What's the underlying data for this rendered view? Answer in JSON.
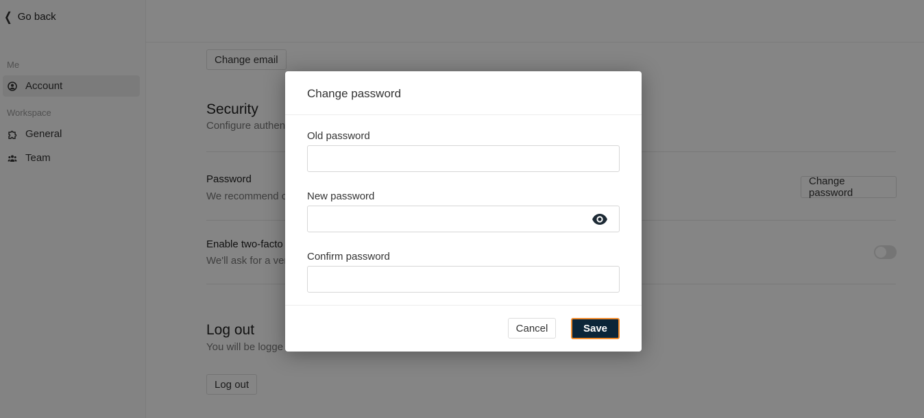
{
  "sidebar": {
    "go_back": "Go back",
    "section_me": "Me",
    "section_workspace": "Workspace",
    "items": [
      {
        "label": "Account",
        "icon": "user-circle-icon",
        "active": true
      },
      {
        "label": "General",
        "icon": "puzzle-icon",
        "active": false
      },
      {
        "label": "Team",
        "icon": "team-icon",
        "active": false
      }
    ]
  },
  "main": {
    "change_email": "Change email",
    "security_title": "Security",
    "security_subtitle": "Configure authen",
    "password_label": "Password",
    "password_desc": "We recommend c",
    "change_password": "Change password",
    "twofa_label": "Enable two-facto",
    "twofa_desc": "We'll ask for a ver",
    "twofa_enabled": false,
    "logout_title": "Log out",
    "logout_desc": "You will be logge",
    "logout_button": "Log out"
  },
  "modal": {
    "title": "Change password",
    "old_password_label": "Old password",
    "old_password_value": "",
    "new_password_label": "New password",
    "new_password_value": "",
    "confirm_password_label": "Confirm password",
    "confirm_password_value": "",
    "cancel": "Cancel",
    "save": "Save"
  },
  "colors": {
    "save_bg": "#0b2538",
    "save_focus_border": "#f08a2b",
    "overlay": "rgba(0,0,0,0.48)"
  }
}
